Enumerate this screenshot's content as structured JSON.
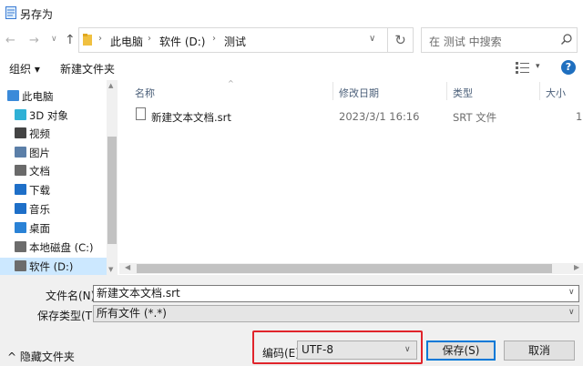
{
  "window": {
    "title": "另存为"
  },
  "nav": {
    "back": "←",
    "forward": "→",
    "history": "∨",
    "up": "↑"
  },
  "address": {
    "crumbs": [
      "此电脑",
      "软件 (D:)",
      "测试"
    ],
    "separator": "›",
    "dropdown": "∨",
    "refresh": "↻"
  },
  "search": {
    "placeholder": "在 测试 中搜索"
  },
  "toolbar": {
    "organize": "组织 ▾",
    "new_folder": "新建文件夹",
    "view_dropdown": "▾",
    "help": "?"
  },
  "sidebar": {
    "items": [
      {
        "label": "此电脑",
        "icon": "computer-icon",
        "color": "#3b8ad9"
      },
      {
        "label": "3D 对象",
        "icon": "cube-3d-icon",
        "color": "#2fb1d6"
      },
      {
        "label": "视频",
        "icon": "video-icon",
        "color": "#444444"
      },
      {
        "label": "图片",
        "icon": "picture-icon",
        "color": "#5b7fa8"
      },
      {
        "label": "文档",
        "icon": "document-icon",
        "color": "#6a6a6a"
      },
      {
        "label": "下载",
        "icon": "download-icon",
        "color": "#1e6fc8"
      },
      {
        "label": "音乐",
        "icon": "music-icon",
        "color": "#1e6fc8"
      },
      {
        "label": "桌面",
        "icon": "desktop-icon",
        "color": "#2a82d6"
      },
      {
        "label": "本地磁盘 (C:)",
        "icon": "drive-c-icon",
        "color": "#6c6c6c"
      },
      {
        "label": "软件 (D:)",
        "icon": "drive-d-icon",
        "color": "#6c6c6c",
        "selected": true
      }
    ]
  },
  "filelist": {
    "columns": [
      "名称",
      "修改日期",
      "类型",
      "大小"
    ],
    "sort_arrow": "^",
    "rows": [
      {
        "name": "新建文本文档.srt",
        "modified": "2023/3/1 16:16",
        "type": "SRT 文件",
        "size": "1"
      }
    ]
  },
  "form": {
    "filename_label": "文件名(N):",
    "filename_value": "新建文本文档.srt",
    "filetype_label": "保存类型(T):",
    "filetype_value": "所有文件  (*.*)",
    "encoding_label": "编码(E):",
    "encoding_value": "UTF-8",
    "hide_folders": "^  隐藏文件夹",
    "save": "保存(S)",
    "cancel": "取消",
    "dropdown": "∨"
  },
  "colors": {
    "accent": "#0078d7",
    "highlight_border": "#e0242b",
    "selection": "#cce8ff"
  }
}
